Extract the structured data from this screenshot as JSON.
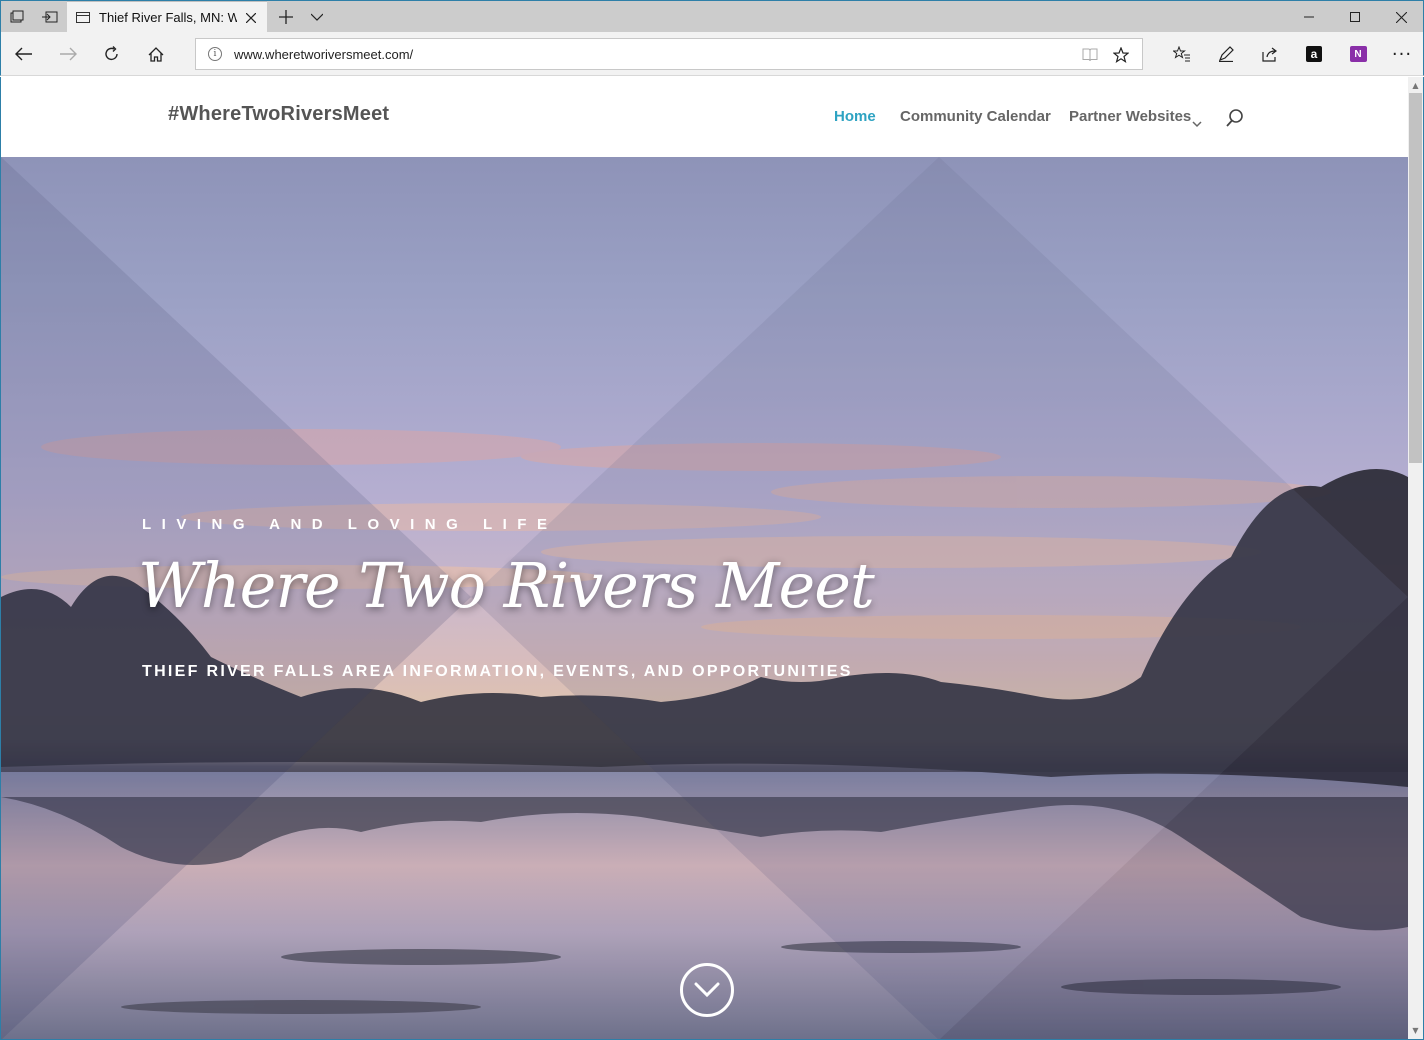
{
  "browser": {
    "tab_title": "Thief River Falls, MN: W",
    "url": "www.wheretworiversmeet.com/",
    "icons": [
      "tab-preview-icon",
      "set-aside-tabs-icon",
      "tab-favicon-icon",
      "close-tab-icon",
      "new-tab-icon",
      "tab-list-icon",
      "minimize-icon",
      "maximize-icon",
      "close-window-icon",
      "back-icon",
      "forward-icon",
      "refresh-icon",
      "home-icon",
      "info-icon",
      "reading-view-icon",
      "favorite-star-icon",
      "favorites-hub-icon",
      "web-note-icon",
      "share-icon",
      "amazon-extension-icon",
      "onenote-extension-icon",
      "more-icon"
    ],
    "amazon_glyph": "a",
    "onenote_glyph": "N",
    "more_glyph": "···"
  },
  "site": {
    "logo": "#WhereTwoRiversMeet",
    "menu": {
      "home": "Home",
      "calendar": "Community Calendar",
      "partners": "Partner Websites"
    },
    "accent_color": "#2ea3c2"
  },
  "hero": {
    "kicker": "LIVING AND LOVING LIFE",
    "title": "Where Two Rivers Meet",
    "subtitle": "THIEF RIVER FALLS AREA INFORMATION, EVENTS, AND OPPORTUNITIES"
  }
}
